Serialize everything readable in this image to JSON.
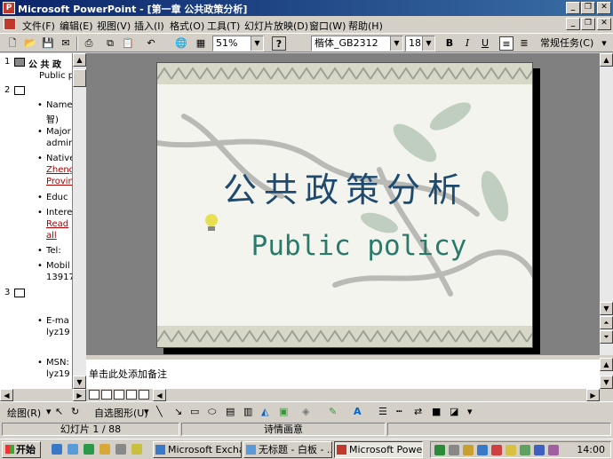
{
  "window": {
    "title": "Microsoft PowerPoint - [第一章 公共政策分析]"
  },
  "menu": [
    "文件(F)",
    "编辑(E)",
    "视图(V)",
    "插入(I)",
    "格式(O)",
    "工具(T)",
    "幻灯片放映(D)",
    "窗口(W)",
    "帮助(H)"
  ],
  "toolbar": {
    "zoom": "51%",
    "font": "楷体_GB2312",
    "font_size": "18",
    "bold": "B",
    "italic": "I",
    "underline": "U",
    "task_pane": "常规任务(C)",
    "help": "?"
  },
  "outline": {
    "slides": [
      {
        "num": "1",
        "title": "公 共 政",
        "subtitle": "Public p"
      },
      {
        "num": "2"
      },
      {
        "num": "3"
      }
    ],
    "bullets": [
      {
        "line1": "Name",
        "line2": "智)"
      },
      {
        "line1": "Major",
        "line2": "admin"
      },
      {
        "line1": "Native",
        "line2": "Zheng",
        "line3": "Provin"
      },
      {
        "line1": "Educ"
      },
      {
        "line1": "Intere",
        "line2": "Read",
        "line3": "all"
      },
      {
        "line1": "Tel:"
      },
      {
        "line1": "Mobil",
        "line2": "13917"
      }
    ],
    "bullets3": [
      {
        "line1": "E-ma",
        "line2": "lyz19"
      },
      {
        "line1": "MSN:",
        "line2": "lyz19"
      }
    ]
  },
  "slide": {
    "title_cn": "公共政策分析",
    "title_en": "Public policy"
  },
  "notes": {
    "placeholder": "单击此处添加备注"
  },
  "drawing": {
    "draw": "绘图(R)",
    "autoshapes": "自选图形(U)"
  },
  "status": {
    "slide": "幻灯片 1 / 88",
    "design": "诗情画意"
  },
  "taskbar": {
    "start": "开始",
    "tasks": [
      "Microsoft Excha...",
      "无标题 - 白板 - ...",
      "Microsoft Power..."
    ],
    "clock": "14:00"
  }
}
